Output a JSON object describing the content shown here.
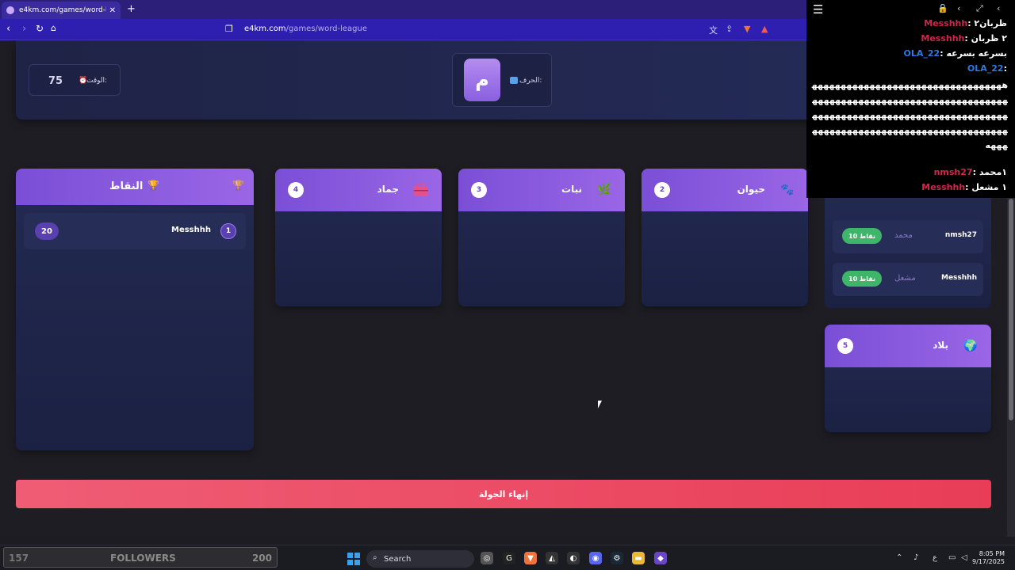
{
  "browser": {
    "tab_title": "e4km.com/games/word-league",
    "url_host": "e4km.com",
    "url_path": "/games/word-league"
  },
  "game": {
    "timer_label": "الوقت:",
    "timer_value": "75",
    "letter_label": "الحرف:",
    "letter": "م",
    "categories": [
      {
        "number": "4",
        "title": "جماد",
        "icon": "toolbox-icon"
      },
      {
        "number": "3",
        "title": "نبات",
        "icon": "plant-icon"
      },
      {
        "number": "2",
        "title": "حيوان",
        "icon": "paw-icon"
      },
      {
        "number": "5",
        "title": "بلاد",
        "icon": "globe-icon"
      }
    ],
    "scoreboard": {
      "title": "النقاط",
      "rows": [
        {
          "rank": "1",
          "name": "Messhhh",
          "points": "20"
        }
      ]
    },
    "answers": [
      {
        "user": "nmsh27",
        "word": "محمد",
        "points": "10 نقاط"
      },
      {
        "user": "Messhhh",
        "word": "مشعل",
        "points": "10 نقاط"
      }
    ],
    "end_round_label": "إنهاء الجولة"
  },
  "chat": {
    "lines": [
      {
        "user": "Messhhh",
        "msg": "ظربان٢",
        "color": "#d0284a"
      },
      {
        "user": "Messhhh",
        "msg": "٢ ظربان",
        "color": "#d0284a"
      },
      {
        "user": "OLA_22",
        "msg": "بسرعه بسرعه",
        "color": "#2d78e6"
      },
      {
        "user": "OLA_22",
        "msg": "",
        "color": "#2d78e6"
      }
    ],
    "spam": "هههههههههههههههههههههههههههههههههههههههههههههههههههههههههههههههههههههههههههههههههههههههههههههههههههههههههههههههههههههههههههههههههههههههههههه",
    "lines_after": [
      {
        "user": "nmsh27",
        "msg": "١محمد",
        "color": "#d0284a"
      },
      {
        "user": "Messhhh",
        "msg": "١ مشعل",
        "color": "#d0284a"
      }
    ]
  },
  "taskbar": {
    "followers_left": "157",
    "followers_label": "FOLLOWERS",
    "followers_right": "200",
    "search_label": "Search",
    "time": "8:05 PM",
    "date": "9/17/2025",
    "lang": "ع"
  }
}
